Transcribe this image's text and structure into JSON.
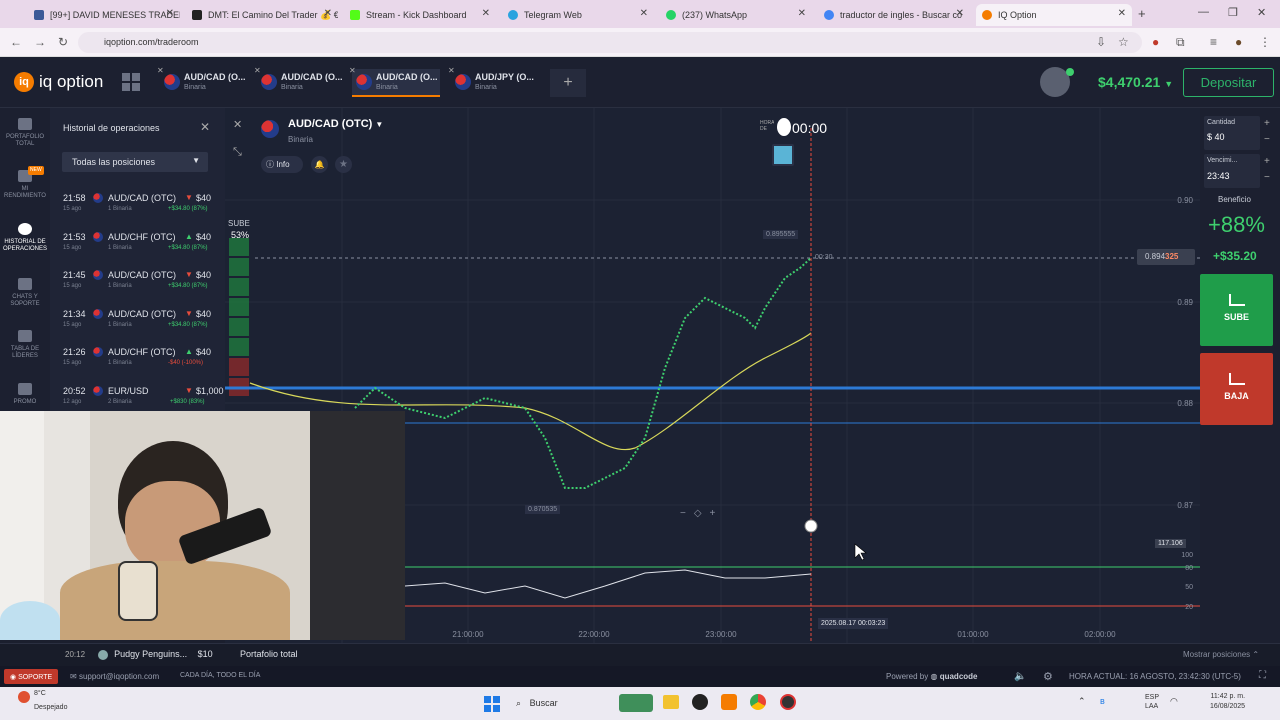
{
  "browser": {
    "tabs": [
      {
        "label": "[99+] DAVID MENESES TRADER",
        "color": "#3b5998"
      },
      {
        "label": "DMT: El Camino Del Trader 💰 €",
        "color": "#222222"
      },
      {
        "label": "Stream - Kick Dashboard",
        "color": "#53fc18"
      },
      {
        "label": "Telegram Web",
        "color": "#2aa3df"
      },
      {
        "label": "(237) WhatsApp",
        "color": "#25d366"
      },
      {
        "label": "traductor de ingles - Buscar co",
        "color": "#4285f4"
      },
      {
        "label": "IQ Option",
        "color": "#f57c00"
      }
    ],
    "url": "iqoption.com/traderoom"
  },
  "app": {
    "logo": "iq option",
    "asset_tabs": [
      {
        "name": "AUD/CAD (O...",
        "type": "Binaria"
      },
      {
        "name": "AUD/CAD (O...",
        "type": "Binaria"
      },
      {
        "name": "AUD/CAD (O...",
        "type": "Binaria"
      },
      {
        "name": "AUD/JPY (O...",
        "type": "Binaria"
      }
    ],
    "add_tab": "+",
    "balance": "$4,470.21",
    "deposit": "Depositar"
  },
  "leftnav": [
    {
      "label": "PORTAFOLIO TOTAL"
    },
    {
      "label": "MI RENDIMIENTO",
      "badge": "NEW"
    },
    {
      "label": "HISTORIAL DE OPERACIONES"
    },
    {
      "label": "CHATS Y SOPORTE"
    },
    {
      "label": "TABLA DE LÍDERES"
    },
    {
      "label": "PROMO"
    }
  ],
  "history": {
    "title": "Historial de operaciones",
    "filter": "Todas las posiciones",
    "rows": [
      {
        "time": "21:58",
        "date": "15 ago",
        "asset": "AUD/CAD (OTC)",
        "sub": "1 Binaria",
        "dir": "down",
        "amount": "$40",
        "profit": "+$34.80 (87%)"
      },
      {
        "time": "21:53",
        "date": "15 ago",
        "asset": "AUD/CHF (OTC)",
        "sub": "1 Binaria",
        "dir": "up",
        "amount": "$40",
        "profit": "+$34.80 (87%)"
      },
      {
        "time": "21:45",
        "date": "15 ago",
        "asset": "AUD/CAD (OTC)",
        "sub": "1 Binaria",
        "dir": "down",
        "amount": "$40",
        "profit": "+$34.80 (87%)"
      },
      {
        "time": "21:34",
        "date": "15 ago",
        "asset": "AUD/CAD (OTC)",
        "sub": "1 Binaria",
        "dir": "down",
        "amount": "$40",
        "profit": "+$34.80 (87%)"
      },
      {
        "time": "21:26",
        "date": "15 ago",
        "asset": "AUD/CHF (OTC)",
        "sub": "1 Binaria",
        "dir": "up",
        "amount": "$40",
        "profit": "-$40 (-100%)"
      },
      {
        "time": "20:52",
        "date": "12 ago",
        "asset": "EUR/USD",
        "sub": "2 Binaria",
        "dir": "down",
        "amount": "$1,000",
        "profit": "+$830 (83%)"
      }
    ],
    "last_row": {
      "time": "20:12",
      "asset": "Pudgy Penguins...",
      "amount": "$10"
    }
  },
  "chart": {
    "asset": "AUD/CAD (OTC)",
    "asset_type": "Binaria",
    "info": "Info",
    "sube_label": "SUBE",
    "sube_pct": "53%",
    "timer": "00:00",
    "timer_prefix": "HORA DE COMPRA",
    "price_tag": "0.894325",
    "price_tag_main": "0.894",
    "price_tag_hi": "325",
    "high_label": "0.895555",
    "low_label": "0.870535",
    "countdown": "00:30",
    "y_ticks": [
      "0.90",
      "0.89",
      "0.88",
      "0.87"
    ],
    "x_ticks": [
      "21:00:00",
      "22:00:00",
      "23:00:00",
      "00:00",
      "01:00:00",
      "02:00:00"
    ],
    "cursor_time": "2025.08.17 00:03:23",
    "osc_value": "117.106",
    "osc_ticks": [
      "100",
      "80",
      "50",
      "20"
    ],
    "zoom_controls": [
      "−",
      "◇",
      "+"
    ]
  },
  "right": {
    "cantidad_label": "Cantidad",
    "cantidad_value": "$ 40",
    "vencimiento_label": "Vencimi...",
    "vencimiento_value": "23:43",
    "beneficio_label": "Beneficio",
    "beneficio_pct": "+88%",
    "beneficio_amt": "+$35.20",
    "sube": "SUBE",
    "baja": "BAJA",
    "colors": {
      "sube": "#1f9d4a",
      "baja": "#c0392b"
    }
  },
  "bottom": {
    "portfolio": "Portafolio total",
    "show_positions": "Mostrar posiciones",
    "soporte": "SOPORTE",
    "email": "support@iqoption.com",
    "schedule": "CADA DÍA, TODO EL DÍA",
    "powered": "Powered by",
    "quadcode": "quadcode",
    "hora_actual": "HORA ACTUAL: 16 AGOSTO, 23:42:30 (UTC-5)"
  },
  "taskbar": {
    "weather_temp": "8°C",
    "weather_desc": "Despejado",
    "search": "Buscar",
    "lang": "ESP",
    "lang2": "LAA",
    "time": "11:42 p. m.",
    "date": "16/08/2025"
  }
}
